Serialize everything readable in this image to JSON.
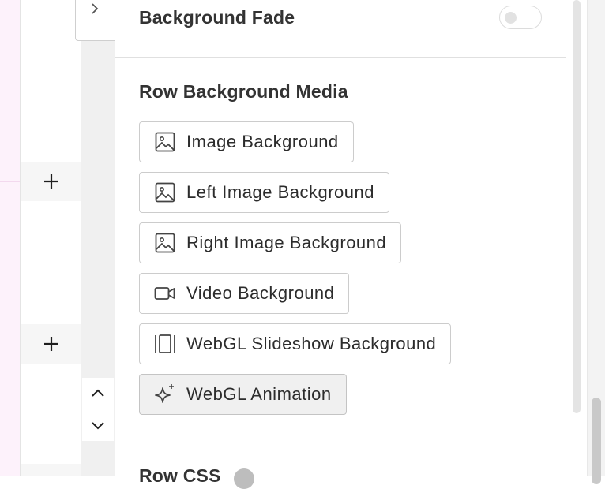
{
  "panel": {
    "fade_label": "Background Fade",
    "fade_enabled": false,
    "media_title": "Row Background Media",
    "next_section_title": "Row CSS"
  },
  "media_buttons": [
    {
      "label": "Image Background",
      "icon": "image-icon"
    },
    {
      "label": "Left Image Background",
      "icon": "image-icon"
    },
    {
      "label": "Right Image Background",
      "icon": "image-icon"
    },
    {
      "label": "Video Background",
      "icon": "video-icon"
    },
    {
      "label": "WebGL Slideshow Background",
      "icon": "slideshow-icon"
    },
    {
      "label": "WebGL Animation",
      "icon": "sparkles-icon",
      "active": true
    }
  ],
  "left_rail": {
    "add_buttons": [
      "plus-icon",
      "plus-icon"
    ],
    "move_controls": [
      "chevron-up-icon",
      "chevron-down-icon"
    ],
    "collapse_icon": "chevron-right-icon"
  },
  "colors": {
    "left_tint": "#fdf2fb",
    "rail_bg": "#f0f0f0",
    "active_button_bg": "#f0f0f0"
  }
}
